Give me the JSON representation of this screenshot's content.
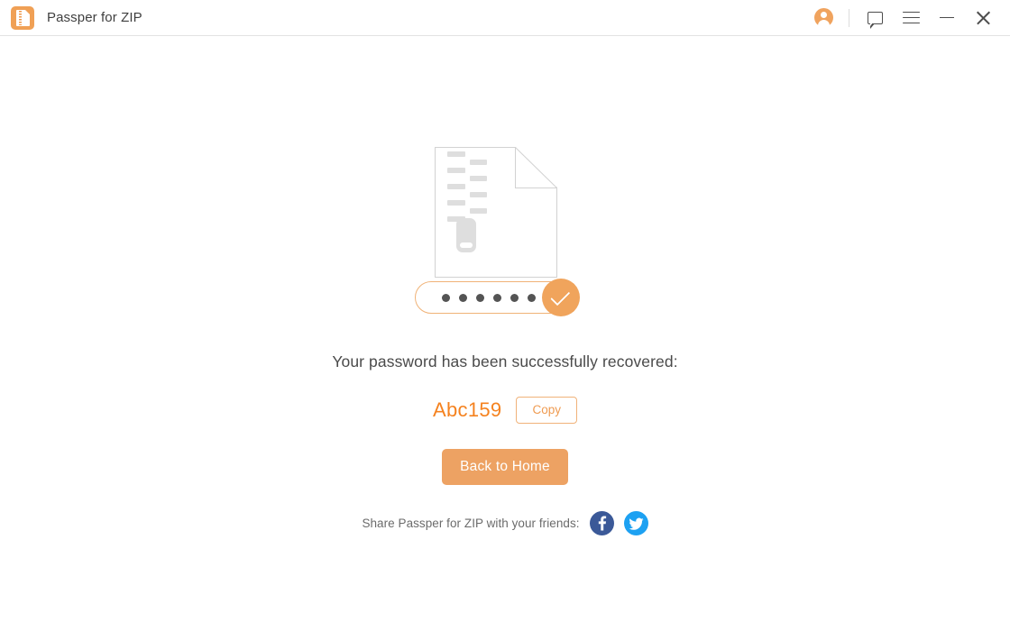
{
  "window": {
    "title": "Passper for ZIP",
    "app_icon": "zip-document-icon",
    "controls": [
      {
        "name": "account-button",
        "icon": "account-circle-icon"
      },
      {
        "name": "feedback-button",
        "icon": "speech-bubble-icon"
      },
      {
        "name": "menu-button",
        "icon": "hamburger-menu-icon"
      },
      {
        "name": "minimize-button",
        "icon": "minimize-icon"
      },
      {
        "name": "close-button",
        "icon": "close-icon"
      }
    ]
  },
  "illustration": {
    "name": "zip-file-success-illustration",
    "document_icon": "zip-document-with-folded-corner",
    "zipper_icon": "zipper-icon",
    "password_dots_count": 6,
    "check_icon": "success-check-icon"
  },
  "main": {
    "headline": "Your password has been successfully recovered:",
    "password": "Abc159",
    "copy_label": "Copy",
    "primary_button_label": "Back to Home"
  },
  "share": {
    "label": "Share Passper for ZIP with your friends:",
    "networks": [
      {
        "name": "facebook",
        "icon": "facebook-icon"
      },
      {
        "name": "twitter",
        "icon": "twitter-icon"
      }
    ]
  },
  "colors": {
    "accent": "#eda263",
    "password_text": "#f5821f",
    "pill_border": "#f0b277",
    "facebook": "#3b5998",
    "twitter": "#1da1f2",
    "title_text": "#3f3f3f",
    "body_text": "#4a4a4a",
    "muted_text": "#6b6b6b"
  }
}
